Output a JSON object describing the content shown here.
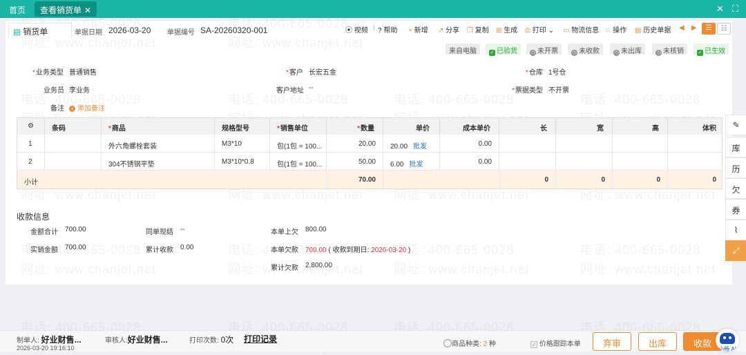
{
  "topbar": {
    "home": "首页",
    "tab": "查看销货单",
    "close_all": "✕",
    "fullscreen": "⛶"
  },
  "header": {
    "title": "销货单",
    "date_label": "单据日期",
    "date": "2026-03-20",
    "no_label": "单据编号",
    "no": "SA-20260320-001"
  },
  "toolbar": {
    "video": "视频",
    "help": "帮助",
    "add": "新增",
    "share": "分享",
    "copy": "复制",
    "generate": "生成",
    "print": "打印",
    "logistics": "物流信息",
    "ops": "操作",
    "history": "历史单据"
  },
  "badges": {
    "source": "来自电脑",
    "verified": "已验货",
    "invoice": "未开票",
    "receive": "未收款",
    "outbound": "未出库",
    "verify": "未核销",
    "effective": "已生效"
  },
  "fields": {
    "biz_type_l": "业务类型",
    "biz_type": "普通销售",
    "customer_l": "客户",
    "customer": "长宏五金",
    "warehouse_l": "仓库",
    "warehouse": "1号仓",
    "salesman_l": "业务员",
    "salesman": "李业务",
    "address_l": "客户地址",
    "address": "--",
    "invoice_type_l": "票据类型",
    "invoice_type": "不开票",
    "note_l": "备注",
    "add_note": "添加备注"
  },
  "table": {
    "headers": [
      "条码",
      "商品",
      "规格型号",
      "销售单位",
      "数量",
      "单价",
      "成本单价",
      "长",
      "宽",
      "高",
      "体积"
    ],
    "rows": [
      {
        "idx": "1",
        "barcode": "",
        "product": "外六角螺栓套装",
        "spec": "M3*10",
        "unit": "包(1包 = 100...",
        "qty": "20.00",
        "price": "20.00",
        "price_link": "批发",
        "cost": "0.00"
      },
      {
        "idx": "2",
        "barcode": "",
        "product": "304不锈钢平垫",
        "spec": "M3*10*0.8",
        "unit": "包(1包 = 100...",
        "qty": "50.00",
        "price": "6.00",
        "price_link": "批发",
        "cost": "0.00"
      }
    ],
    "subtotal": {
      "label": "小计",
      "qty": "70.00",
      "len": "0",
      "wid": "0",
      "hei": "0",
      "vol": "0"
    }
  },
  "payment": {
    "title": "收款信息",
    "total_l": "金额合计",
    "total": "700.00",
    "cash_l": "同单现结",
    "cash": "--",
    "prev_debt_l": "本单上欠",
    "prev_debt": "800.00",
    "actual_l": "实销金额",
    "actual": "700.00",
    "accum_recv_l": "累计收款",
    "accum_recv": "0.00",
    "owe_l": "本单欠款",
    "owe": "700.00",
    "due_pre": "( 收款到期日:",
    "due": "2026-03-20",
    "due_post": ")",
    "accum_debt_l": "累计欠款",
    "accum_debt": "2,800.00"
  },
  "footer": {
    "maker_l": "制单人:",
    "maker": "好业财售...",
    "maker_time": "2026-03-20 19:16:10",
    "auditor_l": "审核人:",
    "auditor": "好业财售...",
    "print_count_l": "打印次数:",
    "print_count": "0次",
    "print_record": "打印记录",
    "kinds_l": "商品种类:",
    "kinds": "2",
    "kinds_unit": "种",
    "price_track": "价格跟踪本单",
    "btn_abandon": "弃审",
    "btn_out": "出库",
    "btn_receive": "收款",
    "ai_label": "小畅 AI"
  },
  "watermark": {
    "phone": "电话: 400-665-0028",
    "site": "网址: www.chanjet.net"
  },
  "colors": {
    "brand": "#19b6a6",
    "accent": "#f08a2c",
    "required": "#e33333",
    "link": "#2a6fd6"
  }
}
